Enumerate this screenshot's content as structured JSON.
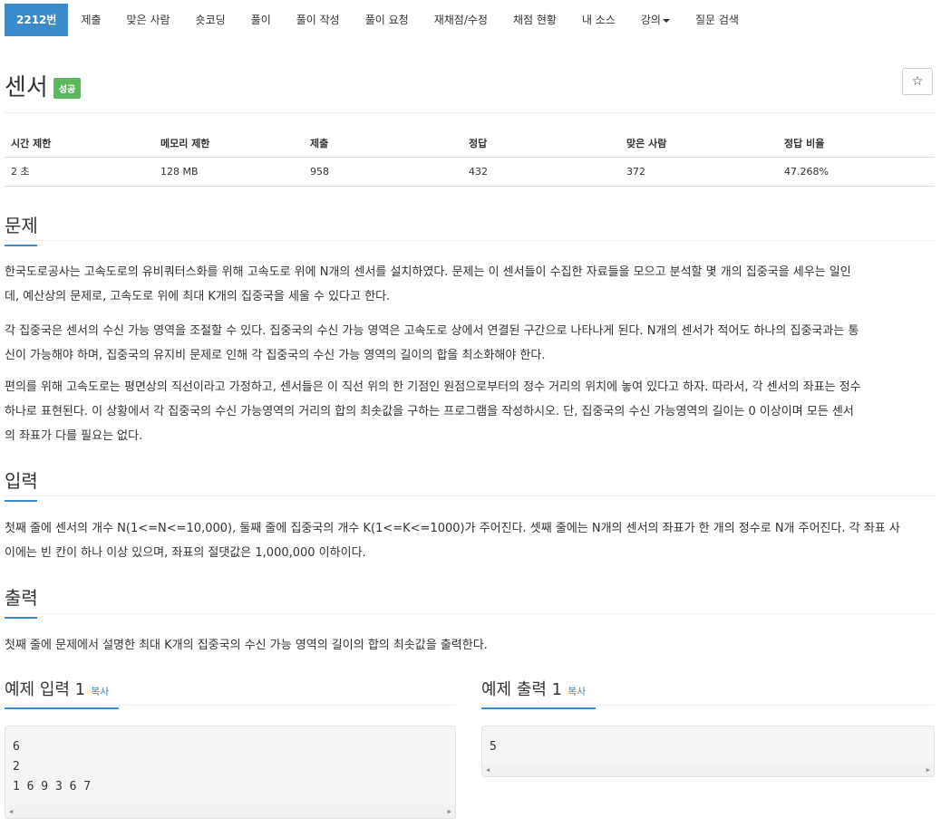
{
  "nav": {
    "items": [
      "2212번",
      "제출",
      "맞은 사람",
      "숏코딩",
      "풀이",
      "풀이 작성",
      "풀이 요청",
      "재채점/수정",
      "채점 현황",
      "내 소스",
      "강의",
      "질문 검색"
    ]
  },
  "problem": {
    "title": "센서",
    "badge": "성공",
    "star": "☆"
  },
  "stats": {
    "headers": [
      "시간 제한",
      "메모리 제한",
      "제출",
      "정답",
      "맞은 사람",
      "정답 비율"
    ],
    "values": [
      "2 초",
      "128 MB",
      "958",
      "432",
      "372",
      "47.268%"
    ]
  },
  "sections": {
    "problem_title": "문제",
    "problem_p1_l1": "한국도로공사는 고속도로의 유비쿼터스화를 위해 고속도로 위에 N개의 센서를 설치하였다. 문제는 이 센서들이 수집한 자료들을 모으고 분석할 몇 개의 집중국을 세우는 일인",
    "problem_p1_l2": "데, 예산상의 문제로, 고속도로 위에 최대 K개의 집중국을 세울 수 있다고 한다.",
    "problem_p2_l1": "각 집중국은 센서의 수신 가능 영역을 조절할 수 있다. 집중국의 수신 가능 영역은 고속도로 상에서 연결된 구간으로 나타나게 된다. N개의 센서가 적어도 하나의 집중국과는 통",
    "problem_p2_l2": "신이 가능해야 하며, 집중국의 유지비 문제로 인해 각 집중국의 수신 가능 영역의 길이의 합을 최소화해야 한다.",
    "problem_p3_l1": "편의를 위해 고속도로는 평면상의 직선이라고 가정하고, 센서들은 이 직선 위의 한 기점인 원점으로부터의 정수 거리의 위치에 놓여 있다고 하자. 따라서, 각 센서의 좌표는 정수",
    "problem_p3_l2": "하나로 표현된다. 이 상황에서 각 집중국의 수신 가능영역의 거리의 합의 최솟값을 구하는 프로그램을 작성하시오. 단, 집중국의 수신 가능영역의 길이는 0 이상이며 모든 센서",
    "problem_p3_l3": "의 좌표가 다를 필요는 없다.",
    "input_title": "입력",
    "input_l1": "첫째 줄에 센서의 개수 N(1<=N<=10,000), 둘째 줄에 집중국의 개수 K(1<=K<=1000)가 주어진다. 셋째 줄에는 N개의 센서의 좌표가 한 개의 정수로 N개 주어진다. 각 좌표 사",
    "input_l2": "이에는 빈 칸이 하나 이상 있으며, 좌표의 절댓값은 1,000,000 이하이다.",
    "output_title": "출력",
    "output_l1": "첫째 줄에 문제에서 설명한 최대 K개의 집중국의 수신 가능 영역의 길이의 합의 최솟값을 출력한다."
  },
  "examples": {
    "input_title": "예제 입력 1",
    "output_title": "예제 출력 1",
    "copy_label": "복사",
    "input_lines": [
      "6",
      "2",
      "1 6 9 3 6 7"
    ],
    "output_lines": [
      "5"
    ]
  }
}
